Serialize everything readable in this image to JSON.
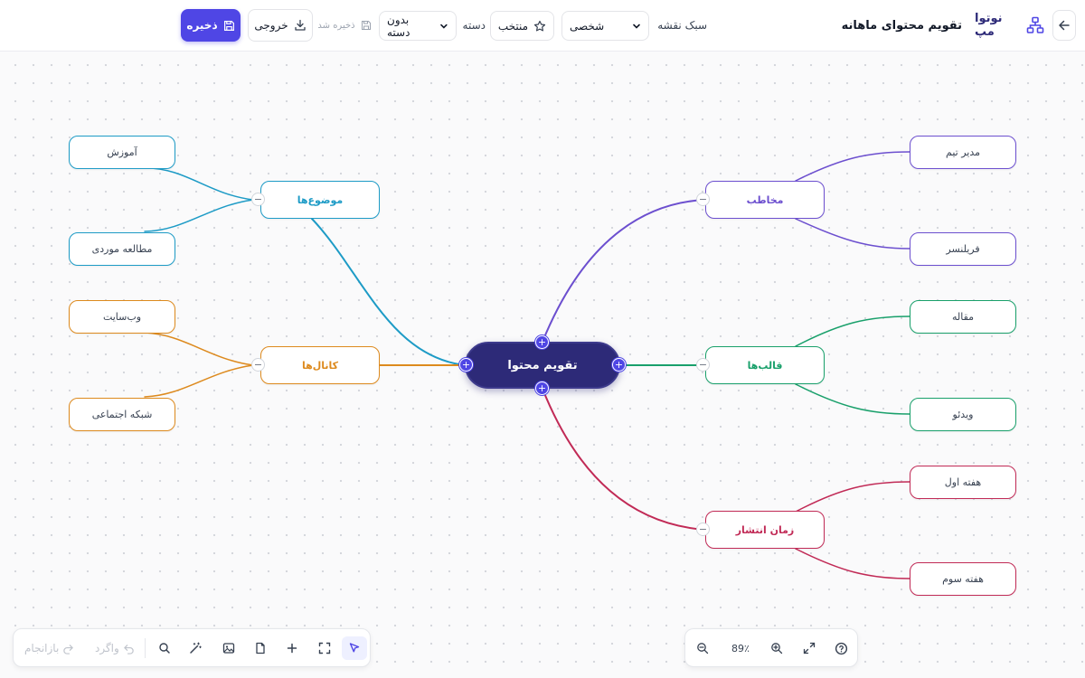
{
  "header": {
    "brand": "نوتوا مپ",
    "doc_title": "تقویم محتوای ماهانه",
    "style_label": "سبک نقشه",
    "style_value": "شخصی",
    "favorite_label": "منتخب",
    "category_label": "دسته",
    "category_value": "بدون دسته",
    "saved_status": "ذخیره شد",
    "export_label": "خروجی",
    "save_label": "ذخیره"
  },
  "colors": {
    "accent": "#4f46e5",
    "center": "#2d2a78",
    "audience": "#6c4fcf",
    "formats": "#19a06b",
    "schedule": "#c12a56",
    "topics": "#1d9bc6",
    "channels": "#dd8a1e"
  },
  "mindmap": {
    "center": "تقویم محتوا",
    "branches": [
      {
        "label": "مخاطب",
        "children": [
          "مدیر تیم",
          "فریلنسر"
        ]
      },
      {
        "label": "قالب‌ها",
        "children": [
          "مقاله",
          "ویدئو"
        ]
      },
      {
        "label": "زمان انتشار",
        "children": [
          "هفته اول",
          "هفته سوم"
        ]
      },
      {
        "label": "موضوع‌ها",
        "children": [
          "آموزش",
          "مطالعه موردی"
        ]
      },
      {
        "label": "کانال‌ها",
        "children": [
          "وب‌سایت",
          "شبکه اجتماعی"
        ]
      }
    ]
  },
  "toolbar": {
    "undo_label": "واگرد",
    "redo_label": "بازانجام"
  },
  "zoom": {
    "value_label": "89٪"
  }
}
